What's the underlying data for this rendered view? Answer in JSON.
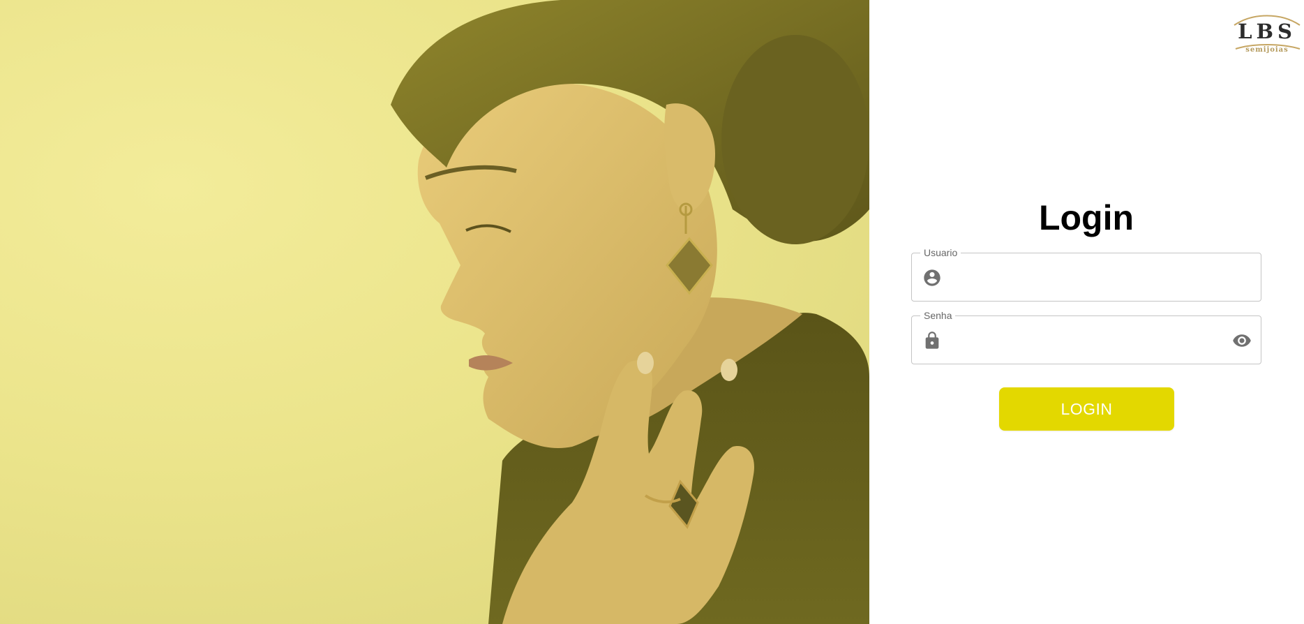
{
  "brand": {
    "logo_text": "LBS",
    "logo_subtext": "semijoias",
    "logo_accent_color": "#c6a663"
  },
  "login": {
    "title": "Login",
    "username_field": {
      "label": "Usuario",
      "value": "",
      "leading_icon": "account-circle-icon"
    },
    "password_field": {
      "label": "Senha",
      "value": "",
      "leading_icon": "lock-icon",
      "trailing_icon": "eye-icon"
    },
    "submit_label": "LOGIN"
  },
  "colors": {
    "accent": "#e3d800",
    "hero_tint": "#ebe48b",
    "border": "#c4c4c4",
    "icon": "#707070"
  },
  "hero": {
    "subject": "woman-with-gold-earring-photo"
  }
}
